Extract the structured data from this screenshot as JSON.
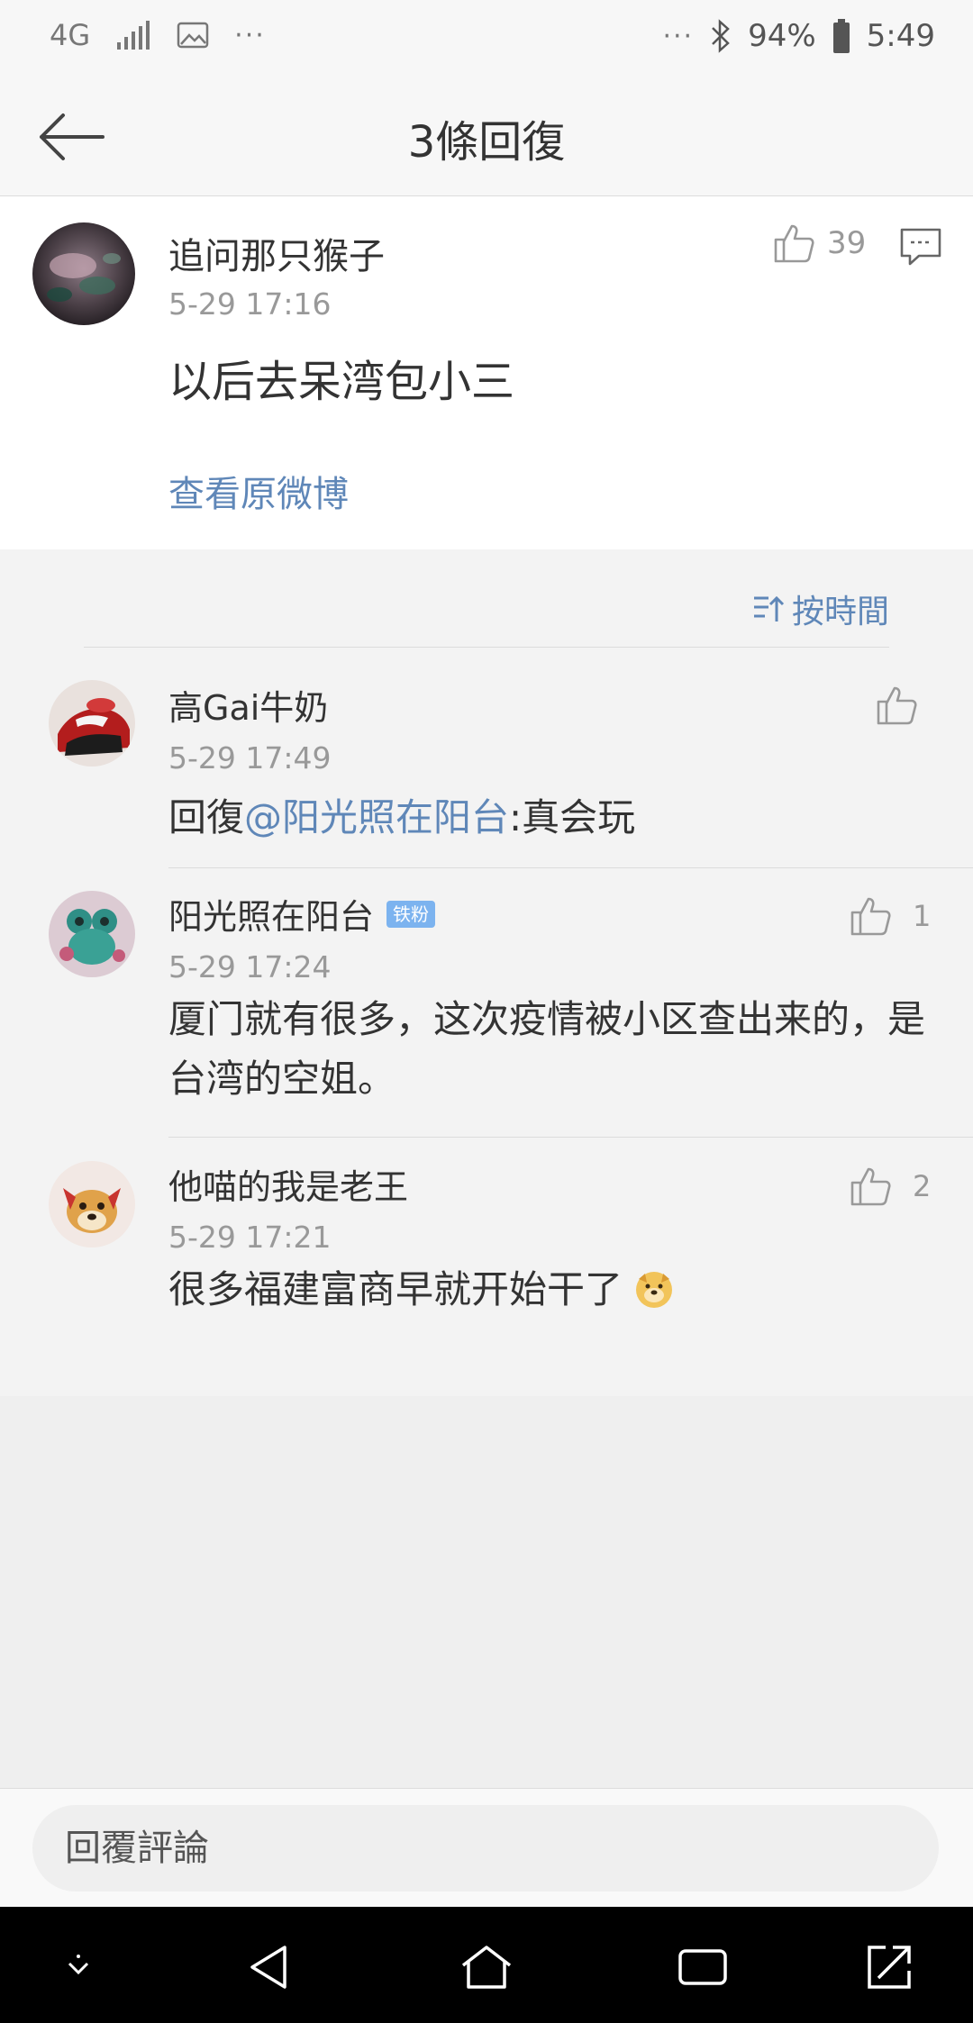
{
  "status_bar": {
    "network": "4G",
    "battery": "94%",
    "time": "5:49",
    "overflow_left": "···",
    "overflow_right": "···"
  },
  "header": {
    "title": "3條回復"
  },
  "main_comment": {
    "user": "追问那只猴子",
    "time": "5-29 17:16",
    "text": "以后去呆湾包小三",
    "likes": "39",
    "view_original": "查看原微博"
  },
  "sort": {
    "label": "按時間"
  },
  "replies": [
    {
      "user": "高Gai牛奶",
      "time": "5-29 17:49",
      "prefix": "回復",
      "mention": "@阳光照在阳台",
      "text": ":真会玩",
      "likes": ""
    },
    {
      "user": "阳光照在阳台",
      "badge": "铁粉",
      "time": "5-29 17:24",
      "text": "厦门就有很多，这次疫情被小区查出来的，是台湾的空姐。",
      "likes": "1"
    },
    {
      "user": "他喵的我是老王",
      "time": "5-29 17:21",
      "text": "很多福建富商早就开始干了",
      "likes": "2"
    }
  ],
  "reply_bar": {
    "placeholder": "回覆評論"
  },
  "colors": {
    "link": "#5f87b8",
    "badge": "#7cb3ef"
  }
}
